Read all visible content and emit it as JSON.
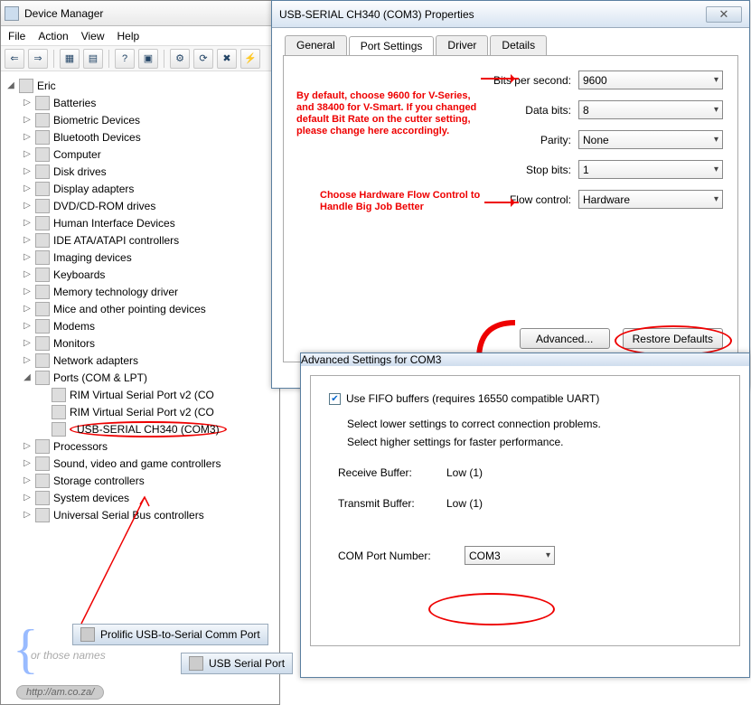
{
  "devmgr": {
    "title": "Device Manager",
    "menu": [
      "File",
      "Action",
      "View",
      "Help"
    ],
    "root": "Eric",
    "items": [
      "Batteries",
      "Biometric Devices",
      "Bluetooth Devices",
      "Computer",
      "Disk drives",
      "Display adapters",
      "DVD/CD-ROM drives",
      "Human Interface Devices",
      "IDE ATA/ATAPI controllers",
      "Imaging devices",
      "Keyboards",
      "Memory technology driver",
      "Mice and other pointing devices",
      "Modems",
      "Monitors",
      "Network adapters"
    ],
    "ports_label": "Ports (COM & LPT)",
    "ports": [
      "RIM Virtual Serial Port v2 (CO",
      "RIM Virtual Serial Port v2 (CO",
      "USB-SERIAL CH340 (COM3)"
    ],
    "after_ports": [
      "Processors",
      "Sound, video and game controllers",
      "Storage controllers",
      "System devices",
      "Universal Serial Bus controllers"
    ],
    "scrap1": "Prolific USB-to-Serial Comm Port",
    "scrap2": "USB Serial Port",
    "or_label": "or those names",
    "url": "http://am.co.za/"
  },
  "props": {
    "title": "USB-SERIAL CH340 (COM3) Properties",
    "tabs": [
      "General",
      "Port Settings",
      "Driver",
      "Details"
    ],
    "fields": {
      "bps_label": "Bits per second:",
      "bps": "9600",
      "databits_label": "Data bits:",
      "databits": "8",
      "parity_label": "Parity:",
      "parity": "None",
      "stopbits_label": "Stop bits:",
      "stopbits": "1",
      "flow_label": "Flow control:",
      "flow": "Hardware"
    },
    "note1": "By default, choose 9600 for V-Series, and 38400 for V-Smart.\nIf you changed default Bit Rate on the cutter setting, please change here accordingly.",
    "note2": "Choose Hardware Flow Control to Handle Big Job Better",
    "advanced_btn": "Advanced...",
    "restore_btn": "Restore Defaults"
  },
  "adv": {
    "title": "Advanced Settings for COM3",
    "fifo_label": "Use FIFO buffers (requires 16550 compatible UART)",
    "line1": "Select lower settings to correct connection problems.",
    "line2": "Select higher settings for faster performance.",
    "recv_label": "Receive Buffer:",
    "recv_val": "Low (1)",
    "trans_label": "Transmit Buffer:",
    "trans_val": "Low (1)",
    "comport_label": "COM Port Number:",
    "comport_val": "COM3"
  }
}
